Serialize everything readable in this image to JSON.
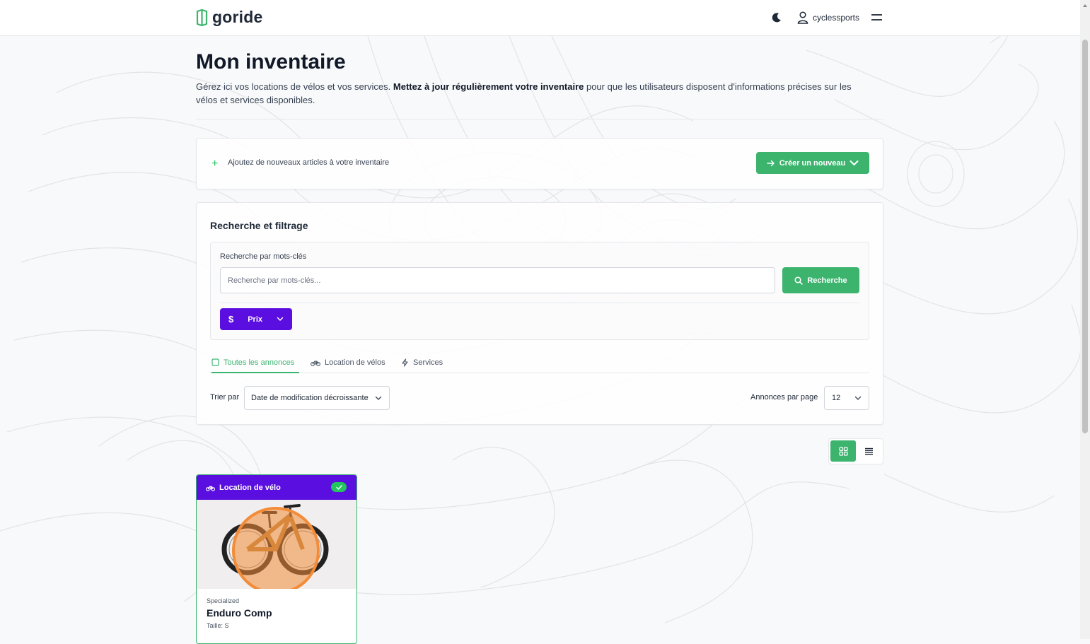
{
  "header": {
    "logo_text": "goride",
    "username": "cyclessports",
    "icons": [
      "logo-mark-icon",
      "moon-icon",
      "user-icon",
      "menu-icon"
    ]
  },
  "page": {
    "title": "Mon inventaire",
    "subtitle_pre": "Gérez ici vos locations de vélos et vos services. ",
    "subtitle_bold": "Mettez à jour régulièrement votre inventaire",
    "subtitle_post": " pour que les utilisateurs disposent d'informations précises sur les vélos et services disponibles."
  },
  "add_section": {
    "text": "Ajoutez de nouveaux articles à votre inventaire",
    "create_button": "Créer un nouveau"
  },
  "filters": {
    "title": "Recherche et filtrage",
    "keyword_label": "Recherche par mots-clés",
    "keyword_placeholder": "Recherche par mots-clés...",
    "keyword_value": "",
    "search_button": "Recherche",
    "price_button": "Prix",
    "tabs": [
      {
        "label": "Toutes les annonces",
        "active": true
      },
      {
        "label": "Location de vélos",
        "active": false
      },
      {
        "label": "Services",
        "active": false
      }
    ],
    "sort_label": "Trier par",
    "sort_value": "Date de modification décroissante",
    "per_page_label": "Annonces par page",
    "per_page_value": "12"
  },
  "view": {
    "mode": "grid"
  },
  "listings": [
    {
      "category": "Location de vélo",
      "published": true,
      "brand": "Specialized",
      "name": "Enduro Comp",
      "size": "Taille: S"
    }
  ],
  "colors": {
    "primary_green": "#3cb46e",
    "purple": "#5b0ee0",
    "highlight_orange": "#f28c38"
  }
}
